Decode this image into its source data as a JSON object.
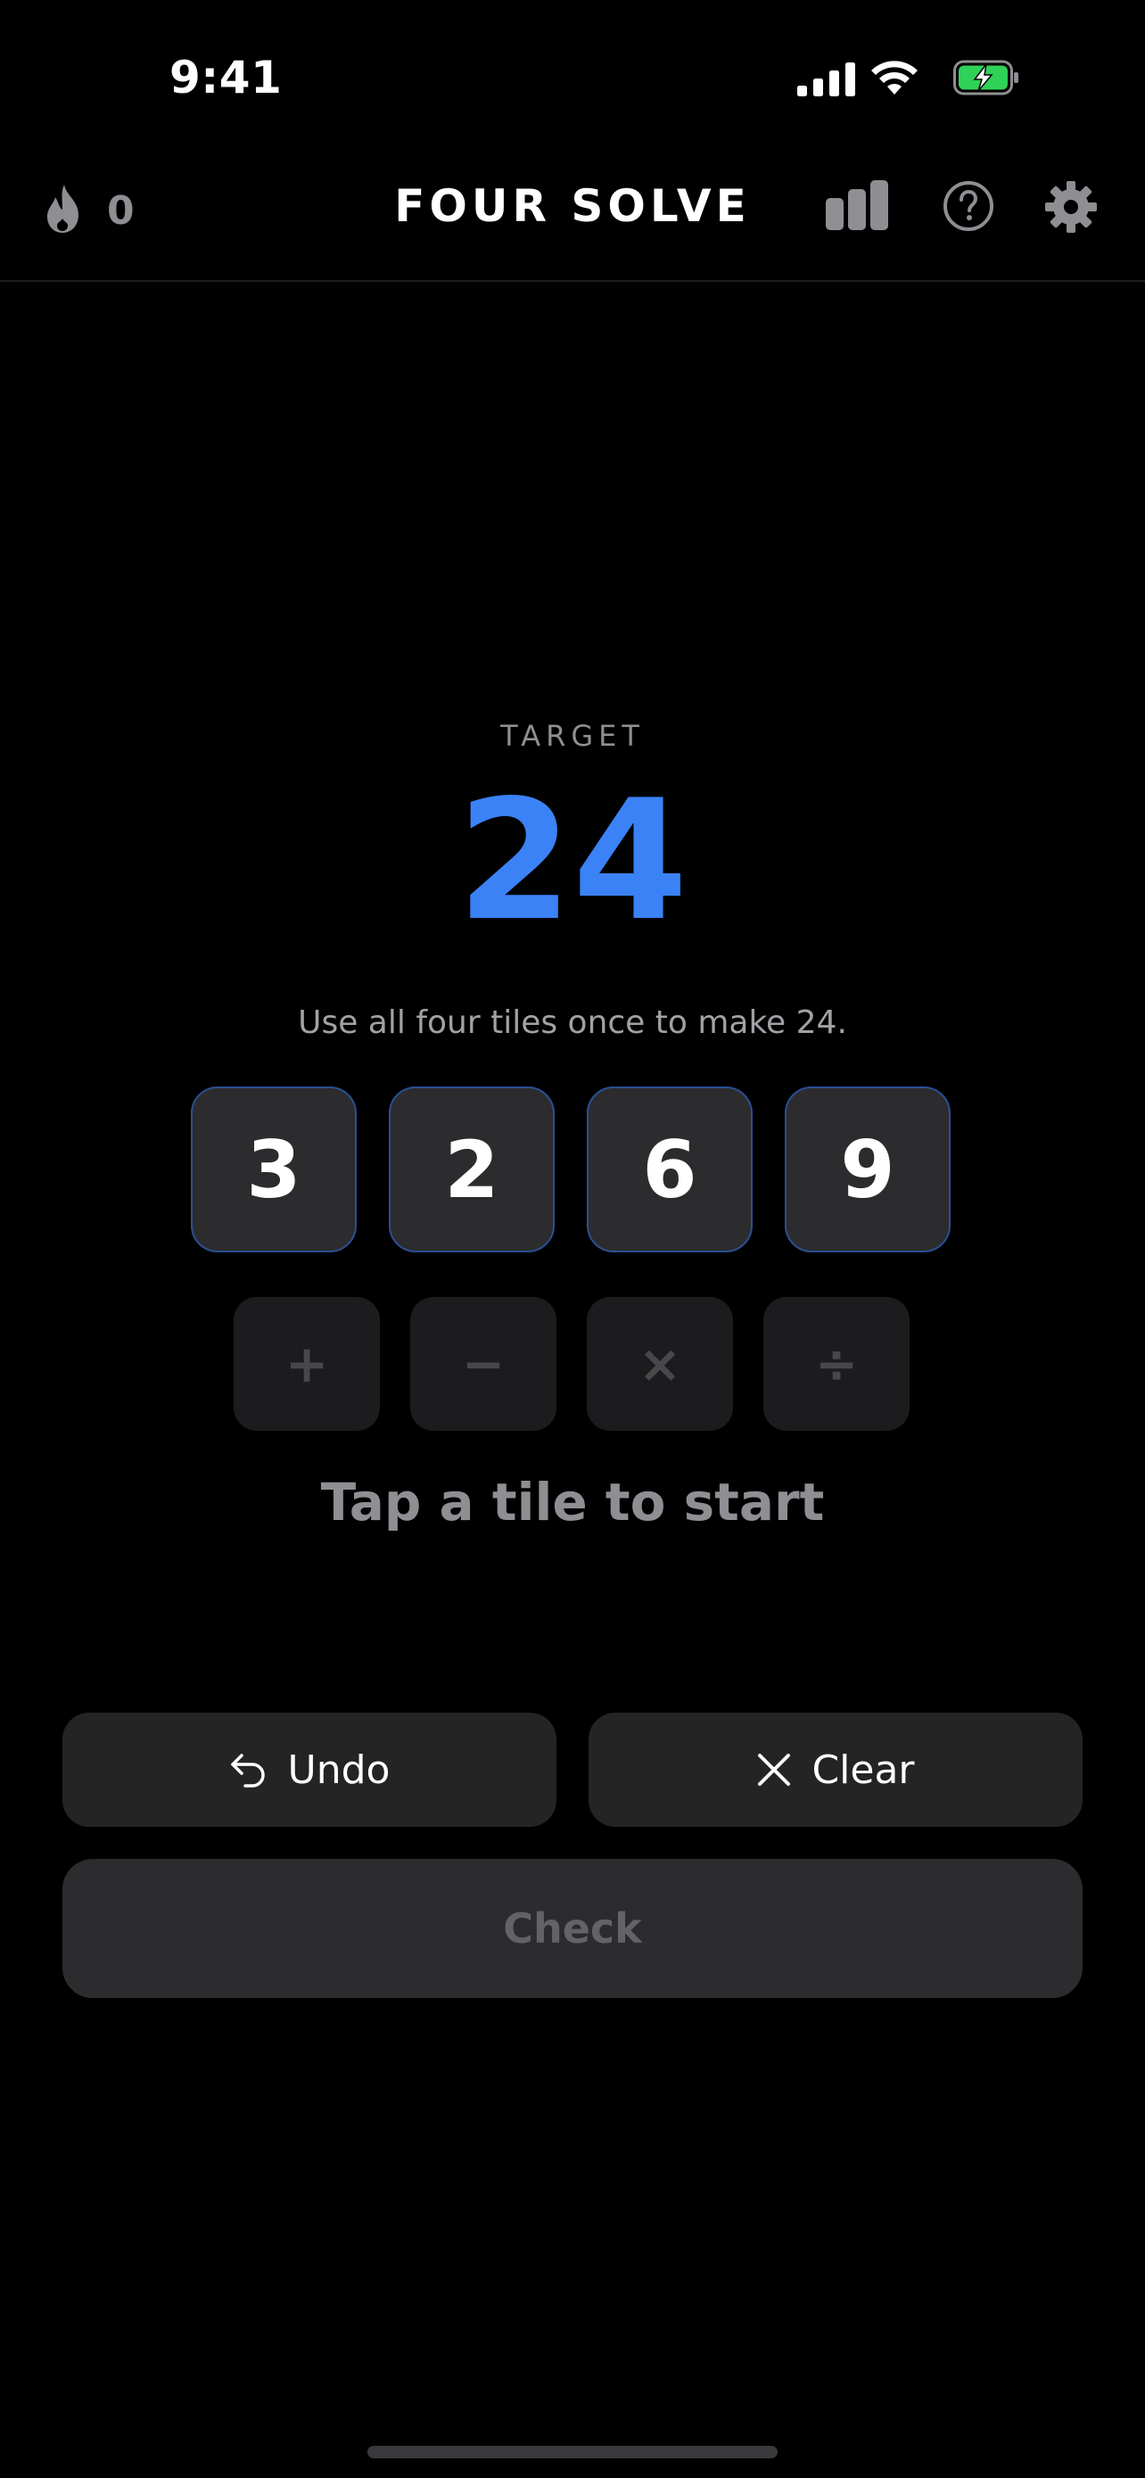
{
  "status_bar": {
    "time": "9:41",
    "battery_color": "#30d158"
  },
  "header": {
    "streak_icon": "flame-icon",
    "streak_count": "0",
    "title": "FOUR SOLVE",
    "stats_icon": "bar-chart-icon",
    "help_icon": "question-circle-icon",
    "settings_icon": "gear-icon"
  },
  "puzzle": {
    "target_label": "TARGET",
    "target_value": "24",
    "instruction": "Use all four tiles once to make 24.",
    "tiles": [
      "3",
      "2",
      "6",
      "9"
    ],
    "operators": [
      "+",
      "−",
      "×",
      "÷"
    ],
    "prompt": "Tap a tile to start"
  },
  "actions": {
    "undo_label": "Undo",
    "clear_label": "Clear",
    "check_label": "Check"
  },
  "colors": {
    "accent": "#3b82f6",
    "tile_border": "#2b4f93",
    "background": "#000000"
  }
}
